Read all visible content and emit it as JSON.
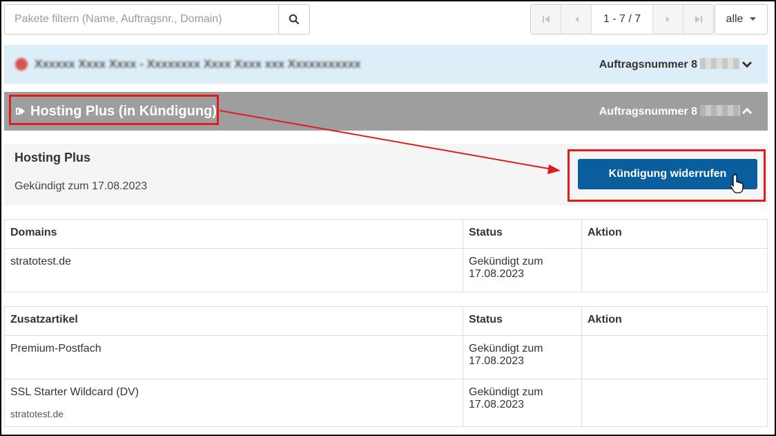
{
  "search": {
    "placeholder": "Pakete filtern (Name, Auftragsnr., Domain)",
    "button_icon": "search-icon"
  },
  "pagination": {
    "range": "1 - 7 / 7",
    "first_icon": "first-page-icon",
    "prev_icon": "prev-page-icon",
    "next_icon": "next-page-icon",
    "last_icon": "last-page-icon"
  },
  "filter": {
    "value": "alle",
    "icon": "caret-down-icon"
  },
  "order1": {
    "title": "Xxxxxx Xxxx Xxxx - Xxxxxxxx Xxxx Xxxx xxx Xxxxxxxxxxx",
    "order_label": "Auftragsnummer 8",
    "expanded": false,
    "icon": "chevron-down-icon"
  },
  "order2": {
    "title": "Hosting Plus (in Kündigung)",
    "title_icon": "sign-out-icon",
    "order_label": "Auftragsnummer 8",
    "expanded": true,
    "icon": "chevron-up-icon"
  },
  "package": {
    "name": "Hosting Plus",
    "cancel_date": "Gekündigt zum 17.08.2023",
    "revoke_button": "Kündigung widerrufen"
  },
  "domains_table": {
    "headers": [
      "Domains",
      "Status",
      "Aktion"
    ],
    "rows": [
      {
        "name": "stratotest.de",
        "status": "Gekündigt zum 17.08.2023",
        "action": ""
      }
    ]
  },
  "addons_table": {
    "headers": [
      "Zusatzartikel",
      "Status",
      "Aktion"
    ],
    "rows": [
      {
        "name": "Premium-Postfach",
        "sub": "",
        "status": "Gekündigt zum 17.08.2023",
        "action": ""
      },
      {
        "name": "SSL Starter Wildcard (DV)",
        "sub": "stratotest.de",
        "status": "Gekündigt zum 17.08.2023",
        "action": ""
      }
    ]
  },
  "colors": {
    "primary_button": "#0a5e9e",
    "highlight_box": "#e01c1c",
    "order_expanded_bg": "#9e9e9e",
    "order_collapsed_bg": "#deeef8"
  }
}
